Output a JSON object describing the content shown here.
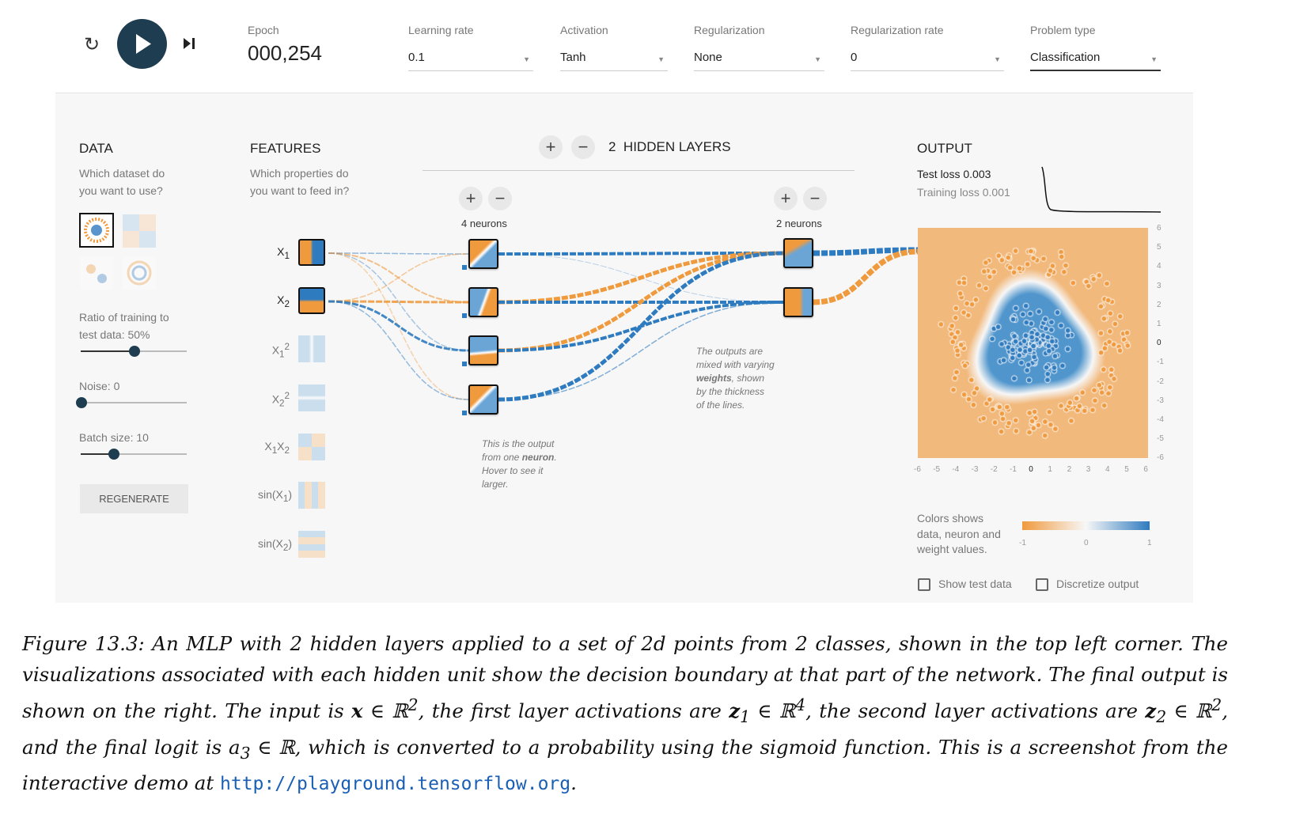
{
  "toolbar": {
    "reset_icon": "reset-icon",
    "play_icon": "play-icon",
    "step_icon": "step-forward-icon",
    "epoch_label": "Epoch",
    "epoch_value": "000,254",
    "learning_rate": {
      "label": "Learning rate",
      "value": "0.1"
    },
    "activation": {
      "label": "Activation",
      "value": "Tanh"
    },
    "regularization": {
      "label": "Regularization",
      "value": "None"
    },
    "regularization_rate": {
      "label": "Regularization rate",
      "value": "0"
    },
    "problem_type": {
      "label": "Problem type",
      "value": "Classification"
    }
  },
  "data_panel": {
    "title": "DATA",
    "subtitle_1": "Which dataset do",
    "subtitle_2": "you want to use?",
    "datasets": [
      "circle",
      "xor",
      "gaussian",
      "spiral"
    ],
    "selected_dataset": "circle",
    "ratio_label": "Ratio of training to",
    "ratio_label_2": "test data:  50%",
    "ratio_value": 50,
    "noise_label": "Noise:  0",
    "noise_value": 0,
    "batch_label": "Batch size:  10",
    "batch_value": 10,
    "regenerate": "REGENERATE"
  },
  "features": {
    "title": "FEATURES",
    "subtitle_1": "Which properties do",
    "subtitle_2": "you want to feed in?",
    "items": [
      {
        "label": "X",
        "sub": "1",
        "sup": "",
        "active": true
      },
      {
        "label": "X",
        "sub": "2",
        "sup": "",
        "active": true
      },
      {
        "label": "X",
        "sub": "1",
        "sup": "2",
        "active": false
      },
      {
        "label": "X",
        "sub": "2",
        "sup": "2",
        "active": false
      },
      {
        "label": "X",
        "sub": "1",
        "mid": "X",
        "sub2": "2",
        "active": false
      },
      {
        "label": "sin(X",
        "sub": "1",
        "end": ")",
        "active": false
      },
      {
        "label": "sin(X",
        "sub": "2",
        "end": ")",
        "active": false
      }
    ]
  },
  "network": {
    "hidden_layers_count": "2",
    "hidden_layers_label": "HIDDEN LAYERS",
    "layers": [
      {
        "neurons_label": "4 neurons"
      },
      {
        "neurons_label": "2 neurons"
      }
    ],
    "note_neuron": [
      "This is the output",
      "from one ",
      "neuron",
      ".",
      "Hover to see it",
      "larger."
    ],
    "note_weights": [
      "The outputs are",
      "mixed with varying",
      "weights",
      ", shown",
      "by the thickness",
      "of the lines."
    ]
  },
  "output": {
    "title": "OUTPUT",
    "test_loss": "Test loss 0.003",
    "training_loss": "Training loss 0.001",
    "y_ticks": [
      "6",
      "5",
      "4",
      "3",
      "2",
      "1",
      "0",
      "-1",
      "-2",
      "-3",
      "-4",
      "-5",
      "-6"
    ],
    "x_ticks": [
      "-6",
      "-5",
      "-4",
      "-3",
      "-2",
      "-1",
      "0",
      "1",
      "2",
      "3",
      "4",
      "5",
      "6"
    ],
    "legend_text_1": "Colors shows",
    "legend_text_2": "data, neuron and",
    "legend_text_3": "weight values.",
    "legend_ticks": [
      "-1",
      "0",
      "1"
    ],
    "show_test_data": "Show test data",
    "discretize_output": "Discretize output",
    "colors": {
      "positive": "#2f7bbf",
      "negative": "#f09a3e",
      "background_negative": "#f2b97d"
    }
  },
  "caption": {
    "p1": "Figure 13.3: An MLP with 2 hidden layers applied to a set of 2d points from 2 classes, shown in the top left corner. The visualizations associated with each hidden unit show the decision boundary at that part of the network. The final output is shown on the right. The input is ",
    "x": "x",
    "in_r": " ∈ ℝ",
    "sup2": "2",
    "p2": ", the first layer activations are ",
    "z1": "z",
    "s1": "1",
    "in_r4": " ∈ ℝ",
    "sup4": "4",
    "p3": ", the second layer activations are ",
    "z2": "z",
    "s2": "2",
    "in_r2": " ∈ ℝ",
    "sup2b": "2",
    "p4": ", and the final logit is ",
    "a": "a",
    "s3": "3",
    "in_r1": " ∈ ℝ",
    "p5": ", which is converted to a probability using the sigmoid function. This is a screenshot from the interactive demo at ",
    "url": "http://playground.tensorflow.org",
    "end": "."
  }
}
